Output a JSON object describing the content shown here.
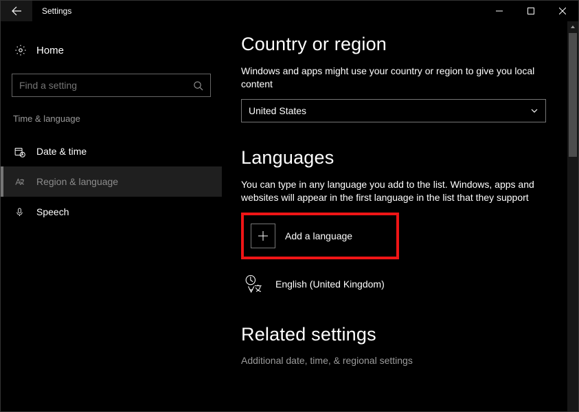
{
  "title": "Settings",
  "sidebar": {
    "home_label": "Home",
    "search_placeholder": "Find a setting",
    "category_label": "Time & language",
    "items": [
      {
        "label": "Date & time"
      },
      {
        "label": "Region & language"
      },
      {
        "label": "Speech"
      }
    ]
  },
  "main": {
    "country_heading": "Country or region",
    "country_desc": "Windows and apps might use your country or region to give you local content",
    "country_value": "United States",
    "languages_heading": "Languages",
    "languages_desc": "You can type in any language you add to the list. Windows, apps and websites will appear in the first language in the list that they support",
    "add_language_label": "Add a language",
    "language_entry": "English (United Kingdom)",
    "related_heading": "Related settings",
    "related_link": "Additional date, time, & regional settings"
  }
}
